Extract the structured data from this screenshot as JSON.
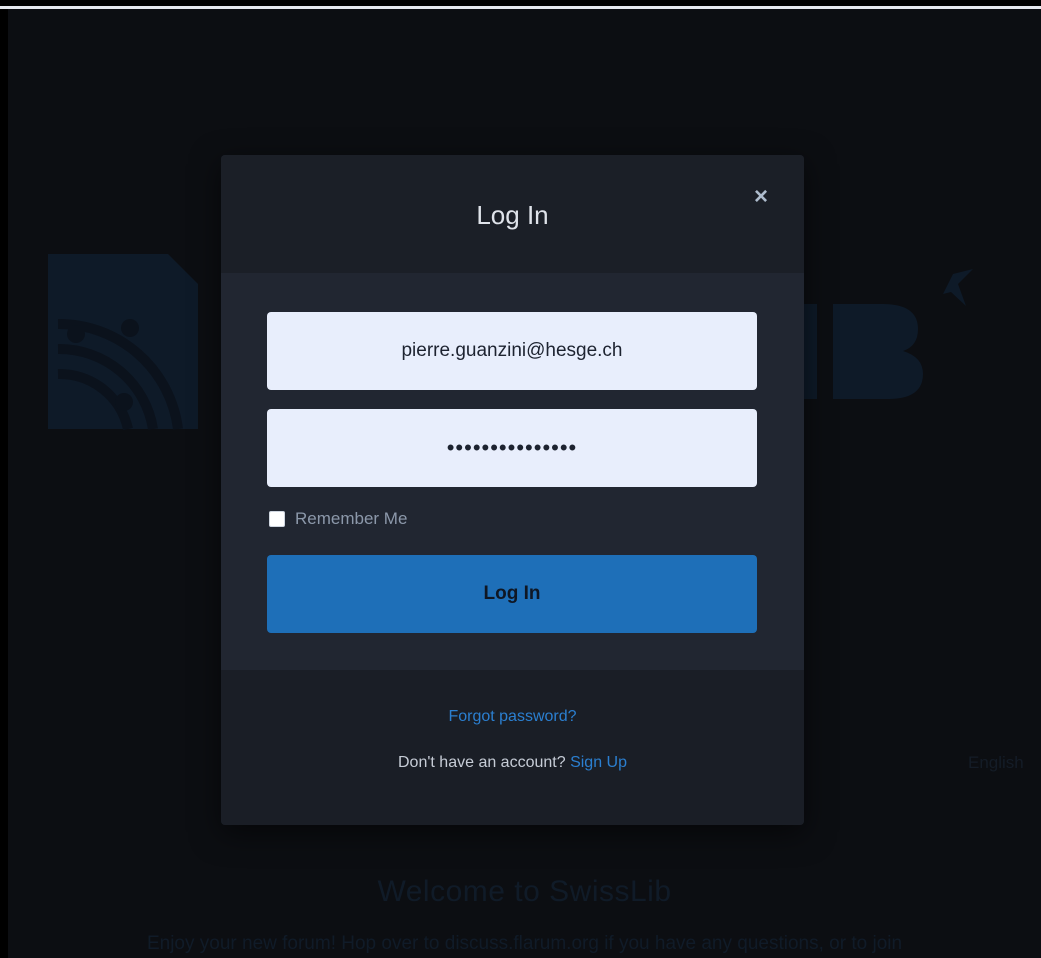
{
  "modal": {
    "title": "Log In",
    "close_label": "×",
    "email_value": "pierre.guanzini@hesge.ch",
    "password_mask": "•••••••••••••••",
    "remember_label": "Remember Me",
    "login_button_label": "Log In",
    "forgot_password_label": "Forgot password?",
    "signup_prompt": "Don't have an account?",
    "signup_link_label": "Sign Up"
  },
  "background": {
    "welcome_title": "Welcome to SwissLib",
    "welcome_text": "Enjoy your new forum! Hop over to discuss.flarum.org if you have any questions, or to join",
    "language_label": "English"
  },
  "icons": {
    "close": "close-icon",
    "logo": "swisslib-logo"
  },
  "colors": {
    "page_background": "#0c0e12",
    "modal_background": "#1a1e26",
    "input_background": "#e8eefc",
    "primary_button": "#1e6fb8",
    "link": "#2b7fd0"
  }
}
